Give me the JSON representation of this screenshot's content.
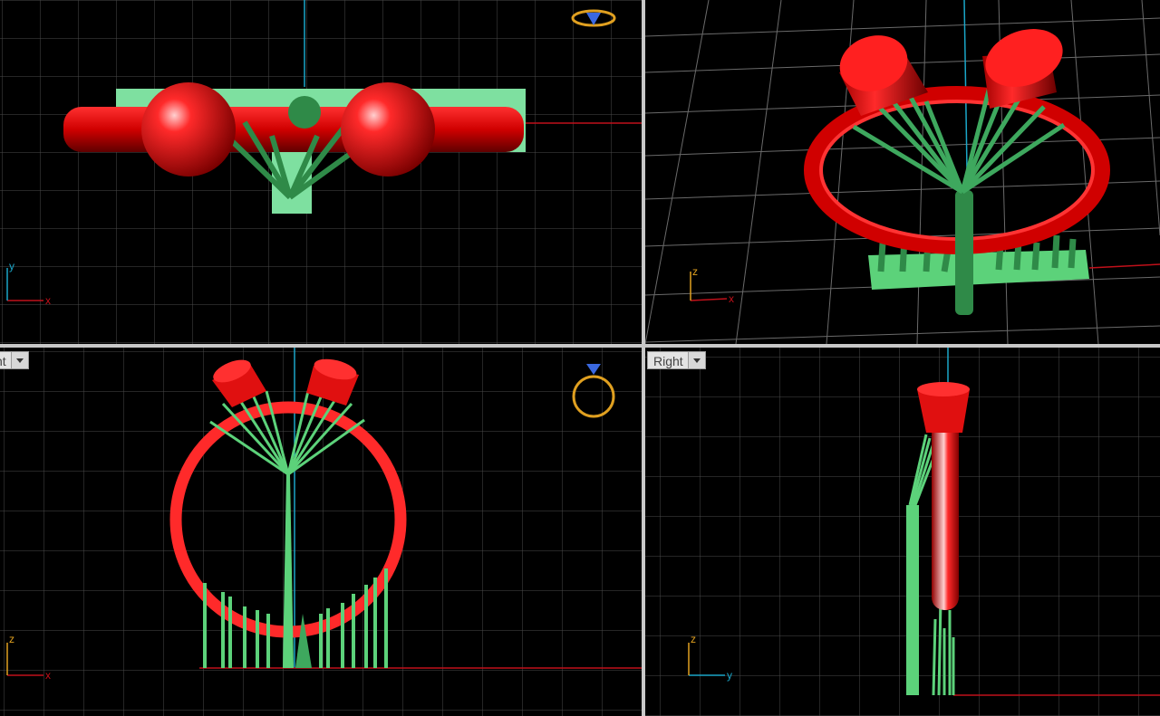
{
  "viewports": {
    "top": {
      "label": "",
      "axes": [
        "y",
        "x"
      ]
    },
    "perspective": {
      "label": "",
      "axes": [
        "z",
        "x"
      ]
    },
    "front": {
      "label": "nt",
      "axes": [
        "z",
        "x"
      ]
    },
    "right": {
      "label": "Right",
      "axes": [
        "z",
        "y"
      ]
    }
  },
  "colors": {
    "background": "#000000",
    "grid": "#5a5a5a",
    "ring": "#ff2020",
    "supports": "#5cd27a",
    "axis_x": "#c0101a",
    "axis_y_or_z": "#1aa6c8",
    "gizmo": "#e0a020"
  },
  "icons": {
    "top_gizmo": "ring-top-view-icon",
    "front_gizmo": "ring-front-view-icon"
  }
}
